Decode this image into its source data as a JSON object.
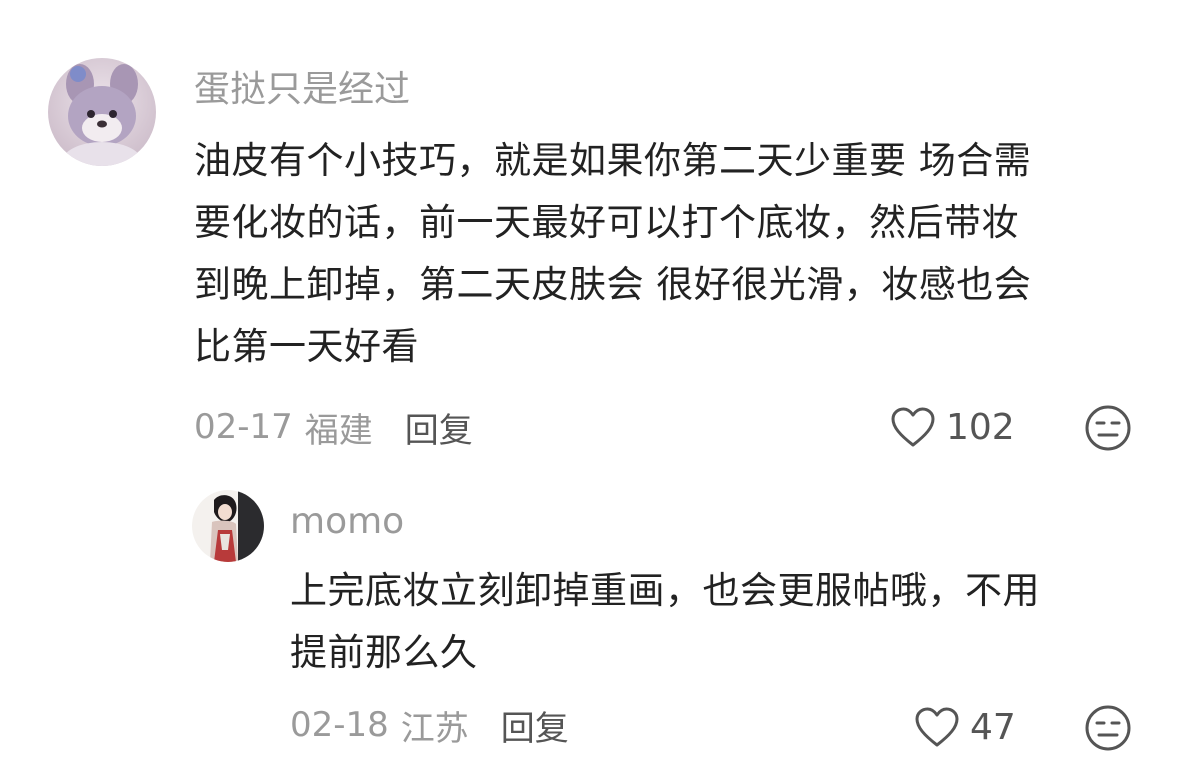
{
  "comments": [
    {
      "username": "蛋挞只是经过",
      "avatar_icon": "plush-toy-avatar-icon",
      "lines": [
        "油皮有个小技巧，就是如果你第二天少重要 场合需",
        "要化妆的话，前一天最好可以打个底妆，然后带妆",
        "到晚上卸掉，第二天皮肤会 很好很光滑，妆感也会",
        "比第一天好看"
      ],
      "date": "02-17",
      "region": "福建",
      "reply_label": "回复",
      "like_count": "102",
      "like_icon": "heart-icon",
      "dislike_icon": "meh-face-icon"
    }
  ],
  "replies": [
    {
      "username": "momo",
      "avatar_icon": "anime-character-avatar-icon",
      "lines": [
        "上完底妆立刻卸掉重画，也会更服帖哦，不用",
        "提前那么久"
      ],
      "date": "02-18",
      "region": "江苏",
      "reply_label": "回复",
      "like_count": "47",
      "like_icon": "heart-icon",
      "dislike_icon": "meh-face-icon"
    }
  ],
  "colors": {
    "text": "#222222",
    "muted": "#9a9a9a",
    "action": "#555555",
    "background": "#ffffff"
  }
}
